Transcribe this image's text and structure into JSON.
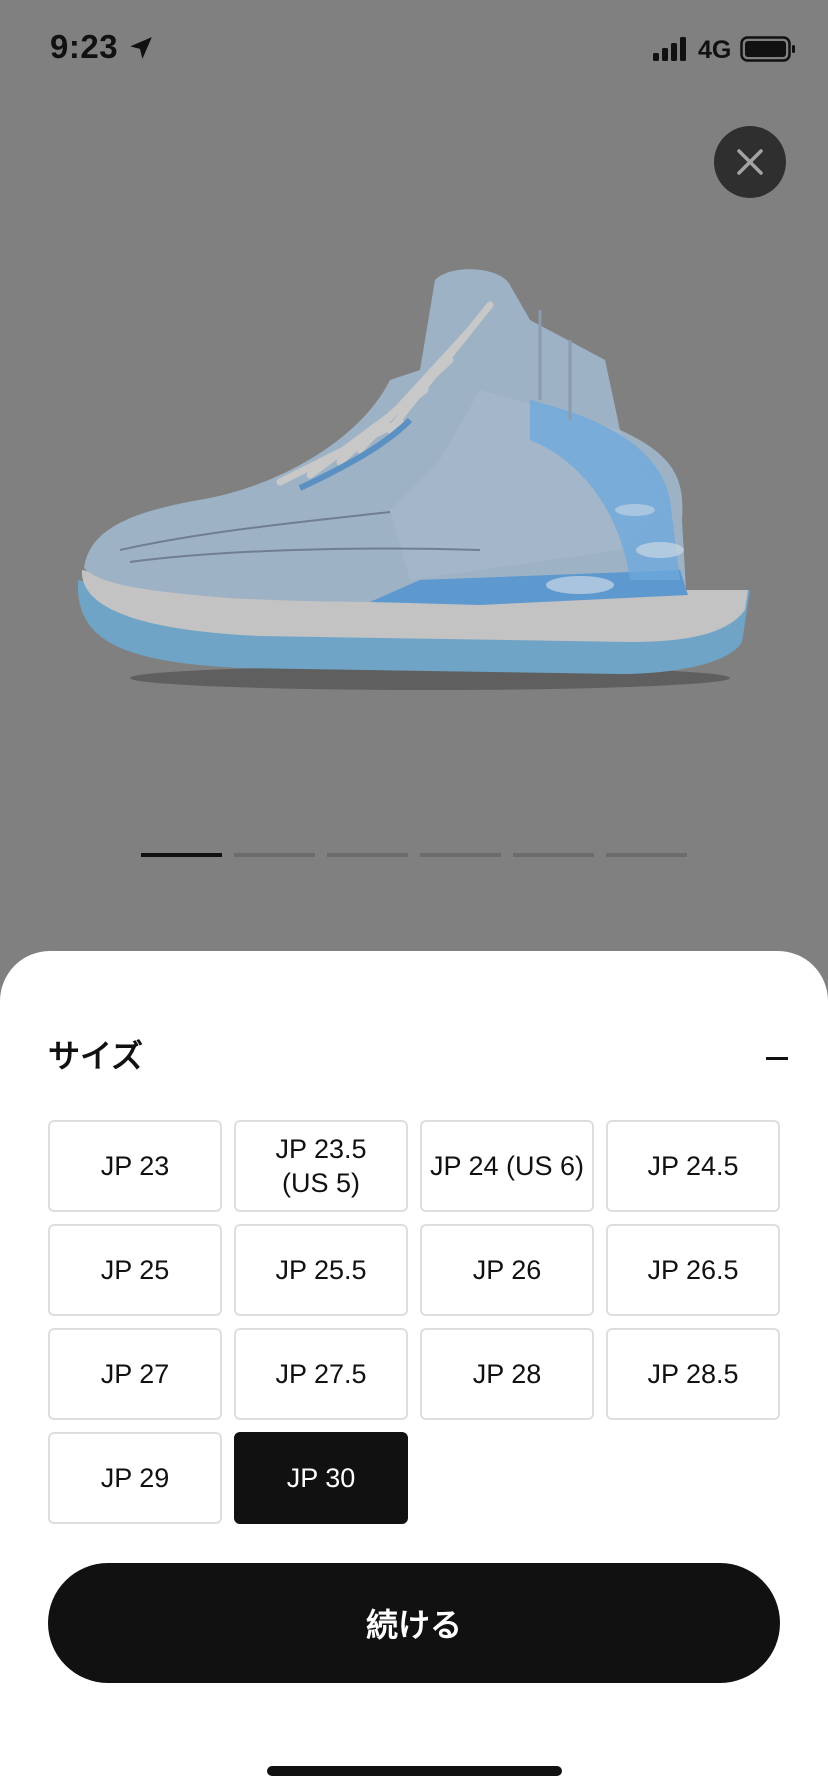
{
  "status_bar": {
    "time": "9:23",
    "network": "4G"
  },
  "product": {
    "image_icon": "sneaker-image",
    "pager": {
      "total": 6,
      "active_index": 0
    }
  },
  "sheet": {
    "title": "サイズ",
    "collapse_icon": "minus-icon",
    "sizes": [
      {
        "label": "JP 23",
        "selected": false
      },
      {
        "label": "JP 23.5\n(US 5)",
        "selected": false
      },
      {
        "label": "JP 24 (US 6)",
        "selected": false
      },
      {
        "label": "JP 24.5",
        "selected": false
      },
      {
        "label": "JP 25",
        "selected": false
      },
      {
        "label": "JP 25.5",
        "selected": false
      },
      {
        "label": "JP 26",
        "selected": false
      },
      {
        "label": "JP 26.5",
        "selected": false
      },
      {
        "label": "JP 27",
        "selected": false
      },
      {
        "label": "JP 27.5",
        "selected": false
      },
      {
        "label": "JP 28",
        "selected": false
      },
      {
        "label": "JP 28.5",
        "selected": false
      },
      {
        "label": "JP 29",
        "selected": false
      },
      {
        "label": "JP 30",
        "selected": true
      }
    ],
    "continue_label": "続ける"
  },
  "colors": {
    "overlay": "#808080",
    "accent": "#111111",
    "sheet_background": "#ffffff"
  }
}
